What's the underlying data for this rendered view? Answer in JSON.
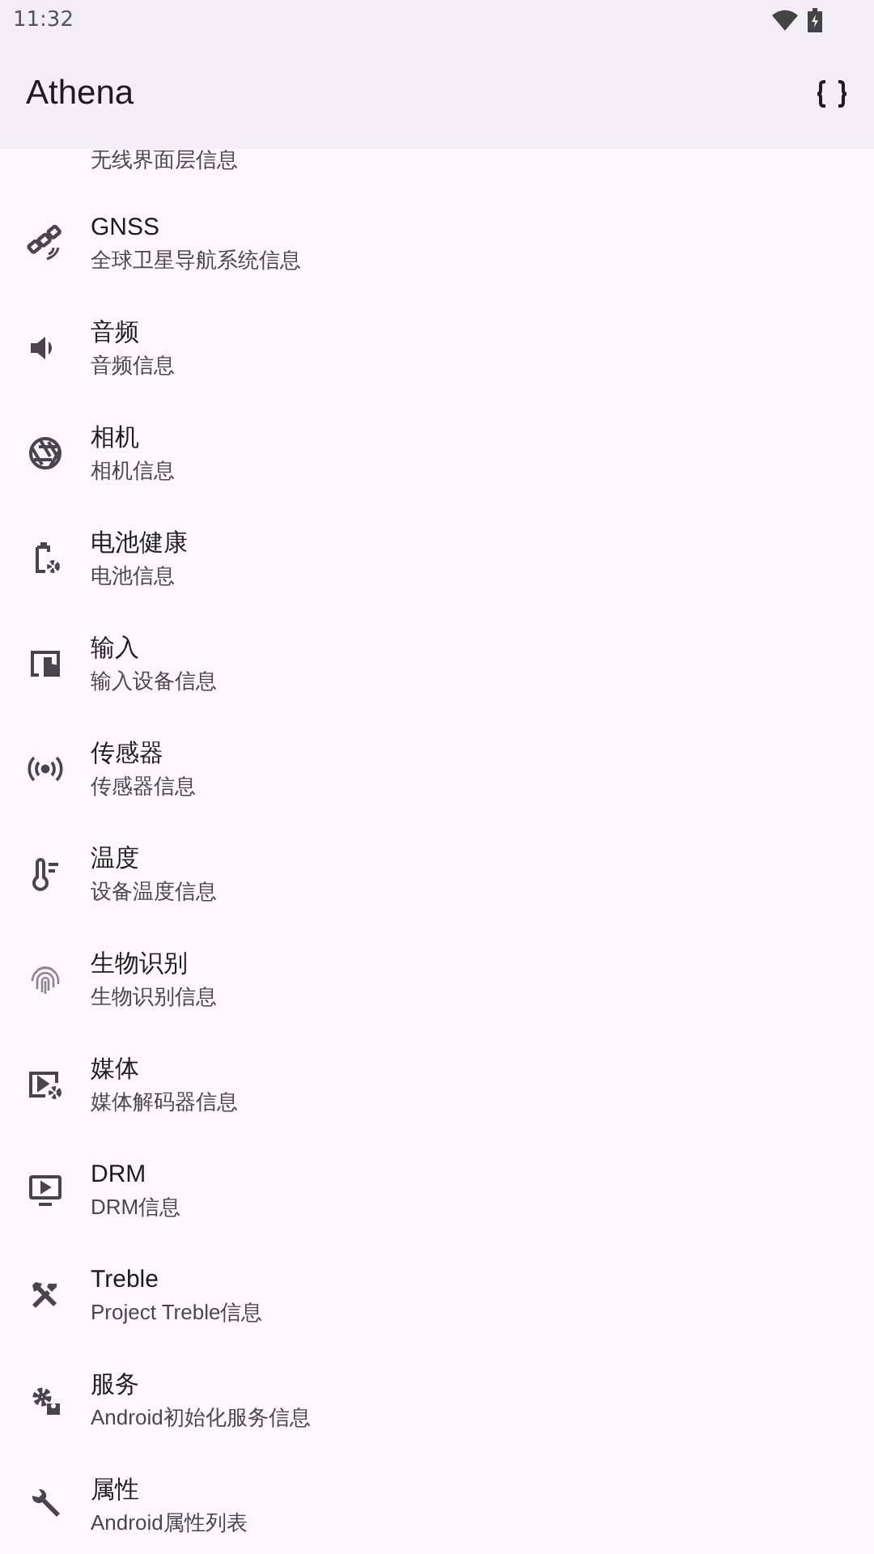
{
  "status_bar": {
    "time": "11:32"
  },
  "app_bar": {
    "title": "Athena"
  },
  "partial_item": {
    "subtitle": "无线界面层信息"
  },
  "items": [
    {
      "kind": "satellite",
      "title": "GNSS",
      "subtitle": "全球卫星导航系统信息"
    },
    {
      "kind": "speaker",
      "title": "音频",
      "subtitle": "音频信息"
    },
    {
      "kind": "aperture",
      "title": "相机",
      "subtitle": "相机信息"
    },
    {
      "kind": "battery",
      "title": "电池健康",
      "subtitle": "电池信息"
    },
    {
      "kind": "touch",
      "title": "输入",
      "subtitle": "输入设备信息"
    },
    {
      "kind": "sensor",
      "title": "传感器",
      "subtitle": "传感器信息"
    },
    {
      "kind": "thermometer",
      "title": "温度",
      "subtitle": "设备温度信息"
    },
    {
      "kind": "fingerprint",
      "title": "生物识别",
      "subtitle": "生物识别信息"
    },
    {
      "kind": "media",
      "title": "媒体",
      "subtitle": "媒体解码器信息"
    },
    {
      "kind": "tv",
      "title": "DRM",
      "subtitle": "DRM信息"
    },
    {
      "kind": "tools",
      "title": "Treble",
      "subtitle": "Project Treble信息"
    },
    {
      "kind": "service",
      "title": "服务",
      "subtitle": "Android初始化服务信息"
    },
    {
      "kind": "wrench",
      "title": "属性",
      "subtitle": "Android属性列表"
    }
  ]
}
